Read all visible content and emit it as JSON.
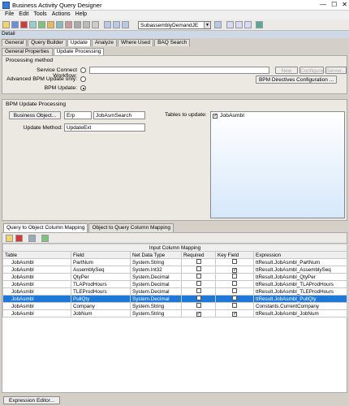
{
  "window": {
    "title": "Business Activity Query Designer",
    "min": "—",
    "max": "☐",
    "close": "✕"
  },
  "menu": [
    "File",
    "Edit",
    "Tools",
    "Actions",
    "Help"
  ],
  "toolbar": {
    "combo_value": "SubassemblyDemandJE"
  },
  "detail_label": "Detail",
  "main_tabs": [
    "General",
    "Query Builder",
    "Update",
    "Analyze",
    "Where Used",
    "BAQ Search"
  ],
  "sub_tabs": [
    "General Properties",
    "Update Processing"
  ],
  "processing": {
    "section": "Processing method",
    "service_label": "Service Connect Workflow:",
    "advanced_label": "Advanced BPM Update only:",
    "bpm_label": "BPM Update:",
    "new": "New",
    "configure": "Configure...",
    "server": "Server...",
    "bpm_config": "BPM Directives Configuration ..."
  },
  "bpm": {
    "section": "BPM Update Processing",
    "business_object": "Business Object...",
    "bo_value1": "Erp",
    "bo_value2": "JobAsmSearch",
    "update_method_label": "Update Method:",
    "update_method": "UpdateExt",
    "tables_label": "Tables to update:",
    "table_item": "JobAsmbl"
  },
  "lower_tabs": [
    "Query to Object Column Mapping",
    "Object to Query Column Mapping"
  ],
  "grid": {
    "group_header": "Input Column Mapping",
    "columns": [
      "Table",
      "Field",
      "Net Data Type",
      "Required",
      "Key Field",
      "Expression"
    ],
    "rows": [
      {
        "table": "JobAsmbl",
        "field": "PartNum",
        "type": "System.String",
        "req": false,
        "key": false,
        "expr": "ttResult.JobAsmbl_PartNum"
      },
      {
        "table": "JobAsmbl",
        "field": "AssemblySeq",
        "type": "System.Int32",
        "req": false,
        "key": true,
        "expr": "ttResult.JobAsmbl_AssemblySeq"
      },
      {
        "table": "JobAsmbl",
        "field": "QtyPer",
        "type": "System.Decimal",
        "req": false,
        "key": false,
        "expr": "ttResult.JobAsmbl_QtyPer"
      },
      {
        "table": "JobAsmbl",
        "field": "TLAProdHours",
        "type": "System.Decimal",
        "req": false,
        "key": false,
        "expr": "ttResult.JobAsmbl_TLAProdHours"
      },
      {
        "table": "JobAsmbl",
        "field": "TLEProdHours",
        "type": "System.Decimal",
        "req": false,
        "key": false,
        "expr": "ttResult.JobAsmbl_TLEProdHours"
      },
      {
        "table": "JobAsmbl",
        "field": "PullQty",
        "type": "System.Decimal",
        "req": false,
        "key": false,
        "expr": "ttResult.JobAsmbl_PullQty"
      },
      {
        "table": "JobAsmbl",
        "field": "Company",
        "type": "System.String",
        "req": false,
        "key": false,
        "expr": "Constants.CurrentCompany"
      },
      {
        "table": "JobAsmbl",
        "field": "JobNum",
        "type": "System.String",
        "req": true,
        "key": true,
        "expr": "ttResult.JobAsmbl_JobNum"
      }
    ]
  },
  "expression_editor": "Expression Editor..."
}
